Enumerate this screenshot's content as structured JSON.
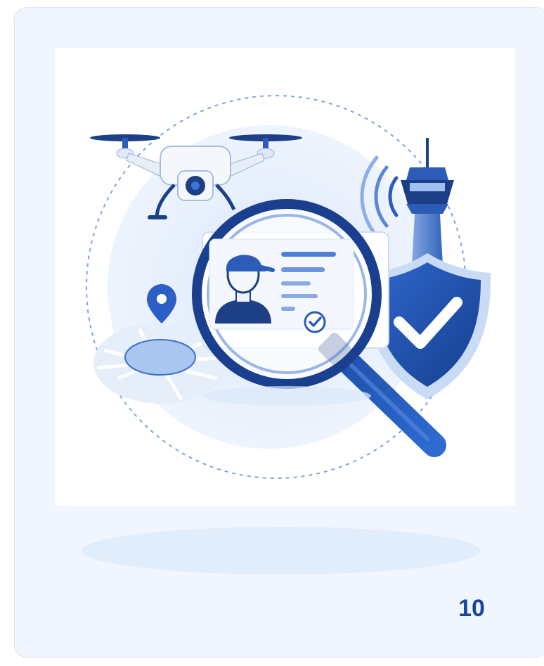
{
  "slide": {
    "page_number": "10"
  },
  "illustration": {
    "icons": [
      "drone-icon",
      "magnifier-icon",
      "id-card-icon",
      "pilot-avatar-icon",
      "check-badge-icon",
      "control-tower-icon",
      "signal-waves-icon",
      "shield-check-icon",
      "map-pin-icon",
      "map-area-icon"
    ]
  },
  "colors": {
    "card_background": "#f1f6fe",
    "accent_dark": "#1a3f8f",
    "accent": "#2a5fc4",
    "accent_light": "#d9e7fb",
    "page_number": "#16469a"
  }
}
